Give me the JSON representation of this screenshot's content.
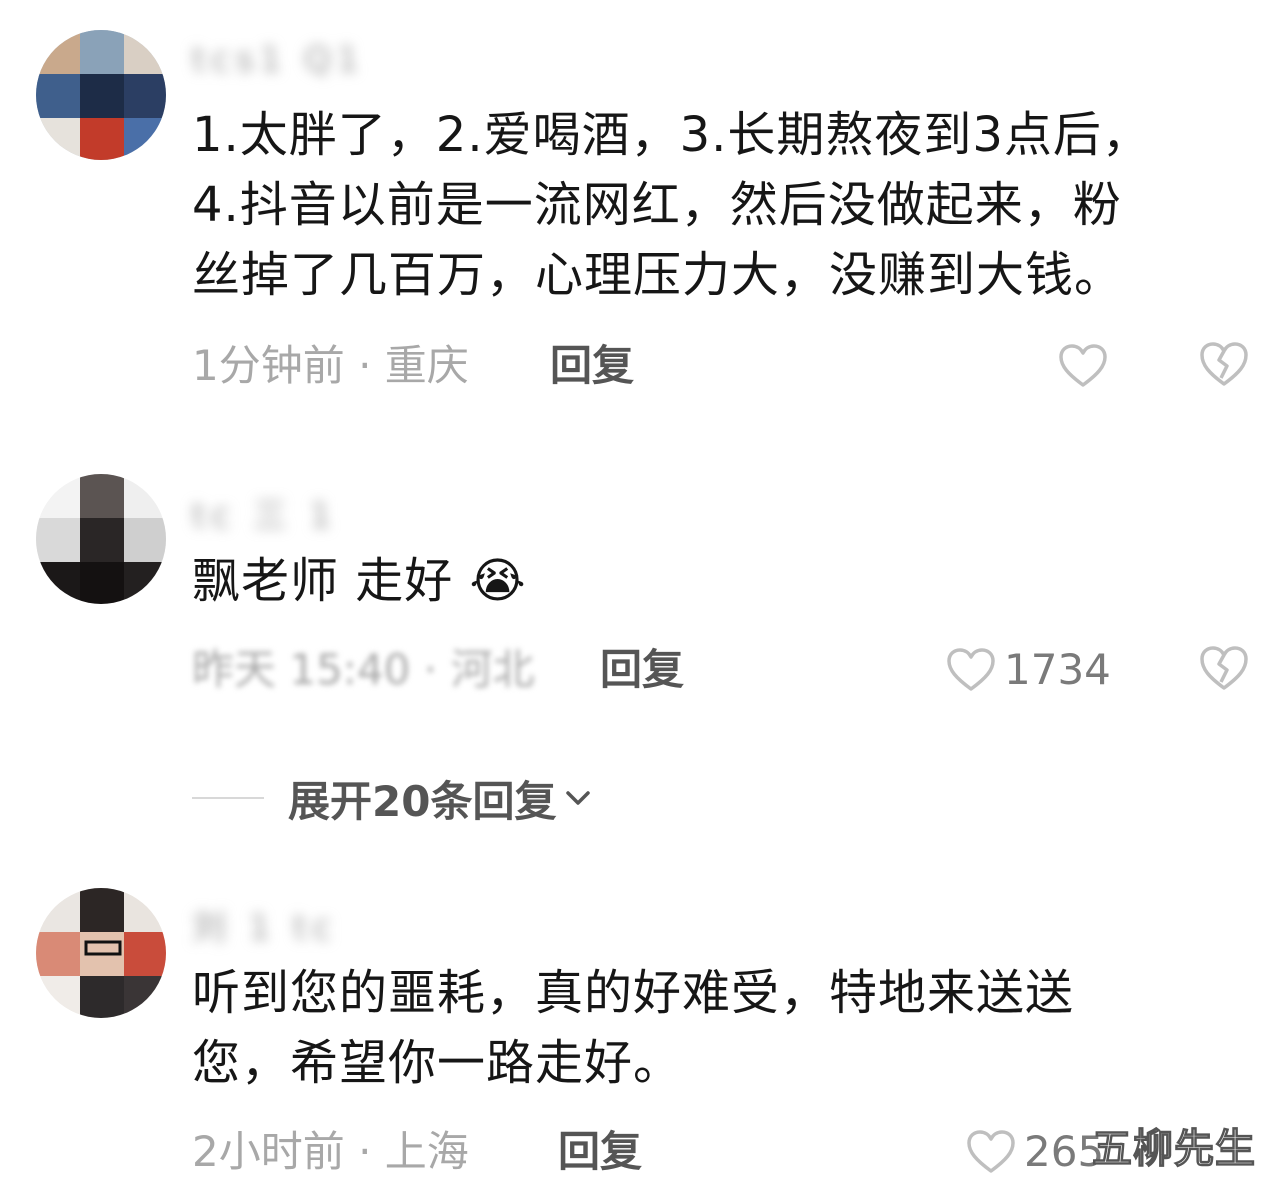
{
  "colors": {
    "text_primary": "#161616",
    "text_muted": "#a8a8a8",
    "reply": "#555555",
    "icon_stroke": "#bfbfbf"
  },
  "comments": [
    {
      "username": "tcs1 Q1",
      "text": "1.太胖了，2.爱喝酒，3.长期熬夜到3点后，\n4.抖音以前是一流网红，然后没做起来，粉\n丝掉了几百万，心理压力大，没赚到大钱。",
      "time_location": "1分钟前 · 重庆",
      "reply_label": "回复",
      "like_count": "",
      "like_icon": "heart-outline-icon",
      "dislike_icon": "broken-heart-icon"
    },
    {
      "username": "tc 三 1",
      "text": "飘老师 走好 😭",
      "time_location": "昨天 15:40 · 河北",
      "reply_label": "回复",
      "like_count": "1734",
      "like_icon": "heart-outline-icon",
      "dislike_icon": "broken-heart-icon"
    },
    {
      "username": "刘 1 tc",
      "text": "听到您的噩耗，真的好难受，特地来送送\n您，希望你一路走好。",
      "time_location": "2小时前 · 上海",
      "reply_label": "回复",
      "like_count": "265",
      "like_icon": "heart-outline-icon",
      "dislike_icon": "broken-heart-icon"
    }
  ],
  "expand_replies": {
    "label": "展开20条回复",
    "icon": "chevron-down-icon"
  },
  "watermark": "五柳先生"
}
